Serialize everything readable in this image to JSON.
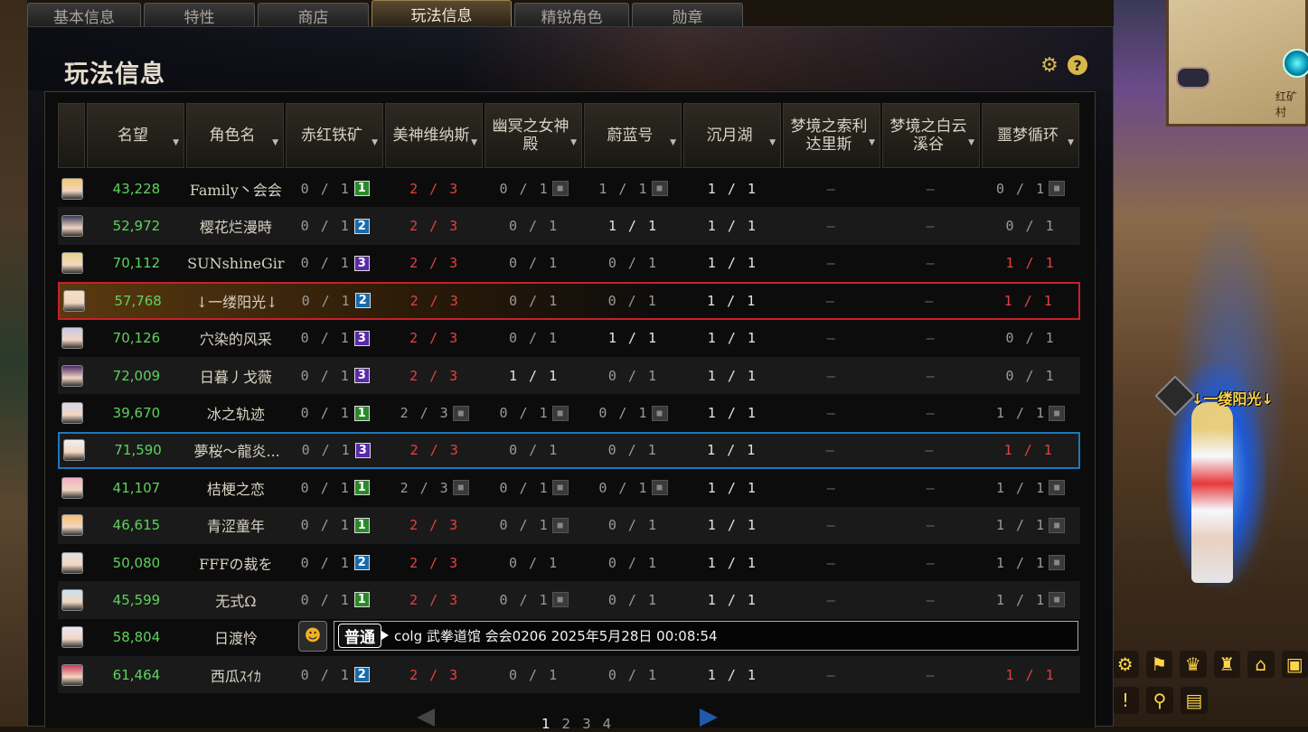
{
  "tabs": [
    "基本信息",
    "特性",
    "商店",
    "玩法信息",
    "精锐角色",
    "勋章"
  ],
  "active_tab": "玩法信息",
  "panel": {
    "title": "玩法信息"
  },
  "columns": [
    {
      "label": "名望"
    },
    {
      "label": "角色名"
    },
    {
      "label": "赤红铁矿"
    },
    {
      "label": "美神维纳斯"
    },
    {
      "label": "幽冥之女神殿"
    },
    {
      "label": "蔚蓝号"
    },
    {
      "label": "沉月湖"
    },
    {
      "label": "梦境之索利达里斯"
    },
    {
      "label": "梦境之白云溪谷"
    },
    {
      "label": "噩梦循环"
    }
  ],
  "rows": [
    {
      "fame": "43,228",
      "name": "Family丶会会",
      "q": [
        {
          "t": "0 / 1",
          "c": "gray",
          "badge": "1",
          "bc": "g"
        },
        {
          "t": "2 / 3",
          "c": "red"
        },
        {
          "t": "0 / 1",
          "c": "gray",
          "lock": true
        },
        {
          "t": "1 / 1",
          "c": "gray",
          "lock": true
        },
        {
          "t": "1 / 1",
          "c": "white"
        },
        {
          "t": "–",
          "c": "dash"
        },
        {
          "t": "–",
          "c": "dash"
        },
        {
          "t": "0 / 1",
          "c": "gray",
          "lock": true
        }
      ]
    },
    {
      "fame": "52,972",
      "name": "樱花烂漫時",
      "q": [
        {
          "t": "0 / 1",
          "c": "gray",
          "badge": "2",
          "bc": "b"
        },
        {
          "t": "2 / 3",
          "c": "red"
        },
        {
          "t": "0 / 1",
          "c": "gray"
        },
        {
          "t": "1 / 1",
          "c": "white"
        },
        {
          "t": "1 / 1",
          "c": "white"
        },
        {
          "t": "–",
          "c": "dash"
        },
        {
          "t": "–",
          "c": "dash"
        },
        {
          "t": "0 / 1",
          "c": "gray"
        }
      ]
    },
    {
      "fame": "70,112",
      "name": "SUNshineGir",
      "q": [
        {
          "t": "0 / 1",
          "c": "gray",
          "badge": "3",
          "bc": "p"
        },
        {
          "t": "2 / 3",
          "c": "red"
        },
        {
          "t": "0 / 1",
          "c": "gray"
        },
        {
          "t": "0 / 1",
          "c": "gray"
        },
        {
          "t": "1 / 1",
          "c": "white"
        },
        {
          "t": "–",
          "c": "dash"
        },
        {
          "t": "–",
          "c": "dash"
        },
        {
          "t": "1 / 1",
          "c": "red"
        }
      ]
    },
    {
      "fame": "57,768",
      "name": "↓一缕阳光↓",
      "sel": "red",
      "q": [
        {
          "t": "0 / 1",
          "c": "gray",
          "badge": "2",
          "bc": "b"
        },
        {
          "t": "2 / 3",
          "c": "red"
        },
        {
          "t": "0 / 1",
          "c": "gray"
        },
        {
          "t": "0 / 1",
          "c": "gray"
        },
        {
          "t": "1 / 1",
          "c": "white"
        },
        {
          "t": "–",
          "c": "dash"
        },
        {
          "t": "–",
          "c": "dash"
        },
        {
          "t": "1 / 1",
          "c": "red"
        }
      ]
    },
    {
      "fame": "70,126",
      "name": "穴染的风采",
      "q": [
        {
          "t": "0 / 1",
          "c": "gray",
          "badge": "3",
          "bc": "p"
        },
        {
          "t": "2 / 3",
          "c": "red"
        },
        {
          "t": "0 / 1",
          "c": "gray"
        },
        {
          "t": "1 / 1",
          "c": "white"
        },
        {
          "t": "1 / 1",
          "c": "white"
        },
        {
          "t": "–",
          "c": "dash"
        },
        {
          "t": "–",
          "c": "dash"
        },
        {
          "t": "0 / 1",
          "c": "gray"
        }
      ]
    },
    {
      "fame": "72,009",
      "name": "日暮丿戈薇",
      "q": [
        {
          "t": "0 / 1",
          "c": "gray",
          "badge": "3",
          "bc": "p"
        },
        {
          "t": "2 / 3",
          "c": "red"
        },
        {
          "t": "1 / 1",
          "c": "white"
        },
        {
          "t": "0 / 1",
          "c": "gray"
        },
        {
          "t": "1 / 1",
          "c": "white"
        },
        {
          "t": "–",
          "c": "dash"
        },
        {
          "t": "–",
          "c": "dash"
        },
        {
          "t": "0 / 1",
          "c": "gray"
        }
      ]
    },
    {
      "fame": "39,670",
      "name": "冰之轨迹",
      "q": [
        {
          "t": "0 / 1",
          "c": "gray",
          "badge": "1",
          "bc": "g"
        },
        {
          "t": "2 / 3",
          "c": "gray",
          "lock": true
        },
        {
          "t": "0 / 1",
          "c": "gray",
          "lock": true
        },
        {
          "t": "0 / 1",
          "c": "gray",
          "lock": true
        },
        {
          "t": "1 / 1",
          "c": "white"
        },
        {
          "t": "–",
          "c": "dash"
        },
        {
          "t": "–",
          "c": "dash"
        },
        {
          "t": "1 / 1",
          "c": "gray",
          "lock": true
        }
      ]
    },
    {
      "fame": "71,590",
      "name": "夢桜～龍炎...",
      "sel": "blue",
      "q": [
        {
          "t": "0 / 1",
          "c": "gray",
          "badge": "3",
          "bc": "p"
        },
        {
          "t": "2 / 3",
          "c": "red"
        },
        {
          "t": "0 / 1",
          "c": "gray"
        },
        {
          "t": "0 / 1",
          "c": "gray"
        },
        {
          "t": "1 / 1",
          "c": "white"
        },
        {
          "t": "–",
          "c": "dash"
        },
        {
          "t": "–",
          "c": "dash"
        },
        {
          "t": "1 / 1",
          "c": "red"
        }
      ]
    },
    {
      "fame": "41,107",
      "name": "桔梗之恋",
      "q": [
        {
          "t": "0 / 1",
          "c": "gray",
          "badge": "1",
          "bc": "g"
        },
        {
          "t": "2 / 3",
          "c": "gray",
          "lock": true
        },
        {
          "t": "0 / 1",
          "c": "gray",
          "lock": true
        },
        {
          "t": "0 / 1",
          "c": "gray",
          "lock": true
        },
        {
          "t": "1 / 1",
          "c": "white"
        },
        {
          "t": "–",
          "c": "dash"
        },
        {
          "t": "–",
          "c": "dash"
        },
        {
          "t": "1 / 1",
          "c": "gray",
          "lock": true
        }
      ]
    },
    {
      "fame": "46,615",
      "name": "青涩童年",
      "q": [
        {
          "t": "0 / 1",
          "c": "gray",
          "badge": "1",
          "bc": "g"
        },
        {
          "t": "2 / 3",
          "c": "red"
        },
        {
          "t": "0 / 1",
          "c": "gray",
          "lock": true
        },
        {
          "t": "0 / 1",
          "c": "gray"
        },
        {
          "t": "1 / 1",
          "c": "white"
        },
        {
          "t": "–",
          "c": "dash"
        },
        {
          "t": "–",
          "c": "dash"
        },
        {
          "t": "1 / 1",
          "c": "gray",
          "lock": true
        }
      ]
    },
    {
      "fame": "50,080",
      "name": "FFFの裁を",
      "q": [
        {
          "t": "0 / 1",
          "c": "gray",
          "badge": "2",
          "bc": "b"
        },
        {
          "t": "2 / 3",
          "c": "red"
        },
        {
          "t": "0 / 1",
          "c": "gray"
        },
        {
          "t": "0 / 1",
          "c": "gray"
        },
        {
          "t": "1 / 1",
          "c": "white"
        },
        {
          "t": "–",
          "c": "dash"
        },
        {
          "t": "–",
          "c": "dash"
        },
        {
          "t": "1 / 1",
          "c": "gray",
          "lock": true
        }
      ]
    },
    {
      "fame": "45,599",
      "name": "无式Ω",
      "q": [
        {
          "t": "0 / 1",
          "c": "gray",
          "badge": "1",
          "bc": "g"
        },
        {
          "t": "2 / 3",
          "c": "red"
        },
        {
          "t": "0 / 1",
          "c": "gray",
          "lock": true
        },
        {
          "t": "0 / 1",
          "c": "gray"
        },
        {
          "t": "1 / 1",
          "c": "white"
        },
        {
          "t": "–",
          "c": "dash"
        },
        {
          "t": "–",
          "c": "dash"
        },
        {
          "t": "1 / 1",
          "c": "gray",
          "lock": true
        }
      ]
    },
    {
      "fame": "58,804",
      "name": "日渡怜",
      "chat": true
    },
    {
      "fame": "61,464",
      "name": "西瓜ｽｲｶ",
      "q": [
        {
          "t": "0 / 1",
          "c": "gray",
          "badge": "2",
          "bc": "b"
        },
        {
          "t": "2 / 3",
          "c": "red"
        },
        {
          "t": "0 / 1",
          "c": "gray"
        },
        {
          "t": "0 / 1",
          "c": "gray"
        },
        {
          "t": "1 / 1",
          "c": "white"
        },
        {
          "t": "–",
          "c": "dash"
        },
        {
          "t": "–",
          "c": "dash"
        },
        {
          "t": "1 / 1",
          "c": "red"
        }
      ]
    }
  ],
  "chat": {
    "channel": "普通",
    "message": "colg 武拳道馆 会会0206 2025年5月28日 00:08:54"
  },
  "pagination": {
    "pages": [
      "1",
      "2",
      "3",
      "4"
    ],
    "current": "1"
  },
  "scene": {
    "character_name": "↓一缕阳光↓",
    "minimap_label": "红矿村"
  },
  "colors": {
    "fame_green": "#5cd35c",
    "progress_red": "#e84040",
    "selected_red_border": "#c8202a",
    "selected_blue_border": "#1e78b8",
    "accent_gold": "#d8b84a"
  }
}
